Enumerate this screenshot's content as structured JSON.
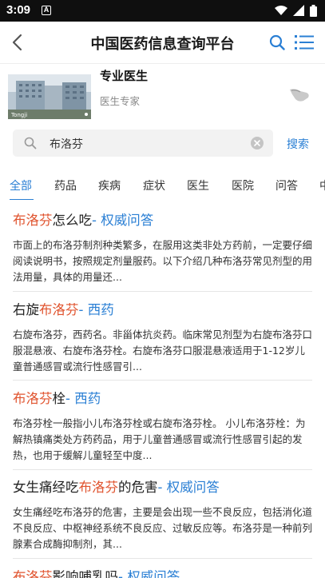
{
  "status_bar": {
    "time": "3:09",
    "notification_glyph": "A"
  },
  "header": {
    "title": "中国医药信息查询平台"
  },
  "doctor_card": {
    "title": "专业医生",
    "subtitle": "医生专家",
    "image_caption": "Tongji"
  },
  "search": {
    "value": "布洛芬",
    "button_label": "搜索"
  },
  "tabs": [
    "全部",
    "药品",
    "疾病",
    "症状",
    "医生",
    "医院",
    "问答",
    "中"
  ],
  "results": [
    {
      "pre": "",
      "hl": "布洛芬",
      "post": "怎么吃",
      "tag": "- 权威问答",
      "desc": "市面上的布洛芬制剂种类繁多，在服用这类非处方药前，一定要仔细阅读说明书，按照规定剂量服药。以下介绍几种布洛芬常见剂型的用法用量，具体的用量还..."
    },
    {
      "pre": "右旋",
      "hl": "布洛芬",
      "post": "",
      "tag": "- 西药",
      "desc": "右旋布洛芬，西药名。非甾体抗炎药。临床常见剂型为右旋布洛芬口服混悬液、右旋布洛芬栓。右旋布洛芬口服混悬液适用于1-12岁儿童普通感冒或流行性感冒引..."
    },
    {
      "pre": "",
      "hl": "布洛芬",
      "post": "栓",
      "tag": "- 西药",
      "desc": "布洛芬栓一般指小儿布洛芬栓或右旋布洛芬栓。 小儿布洛芬栓：为解热镇痛类处方药药品，用于儿童普通感冒或流行性感冒引起的发热，也用于缓解儿童轻至中度..."
    },
    {
      "pre": "女生痛经吃",
      "hl": "布洛芬",
      "post": "的危害",
      "tag": "- 权威问答",
      "desc": "女生痛经吃布洛芬的危害，主要是会出现一些不良反应，包括消化道不良反应、中枢神经系统不良反应、过敏反应等。布洛芬是一种前列腺素合成酶抑制剂，其..."
    },
    {
      "pre": "",
      "hl": "布洛芬",
      "post": "影响哺乳吗",
      "tag": "- 权威问答",
      "desc": ""
    }
  ]
}
